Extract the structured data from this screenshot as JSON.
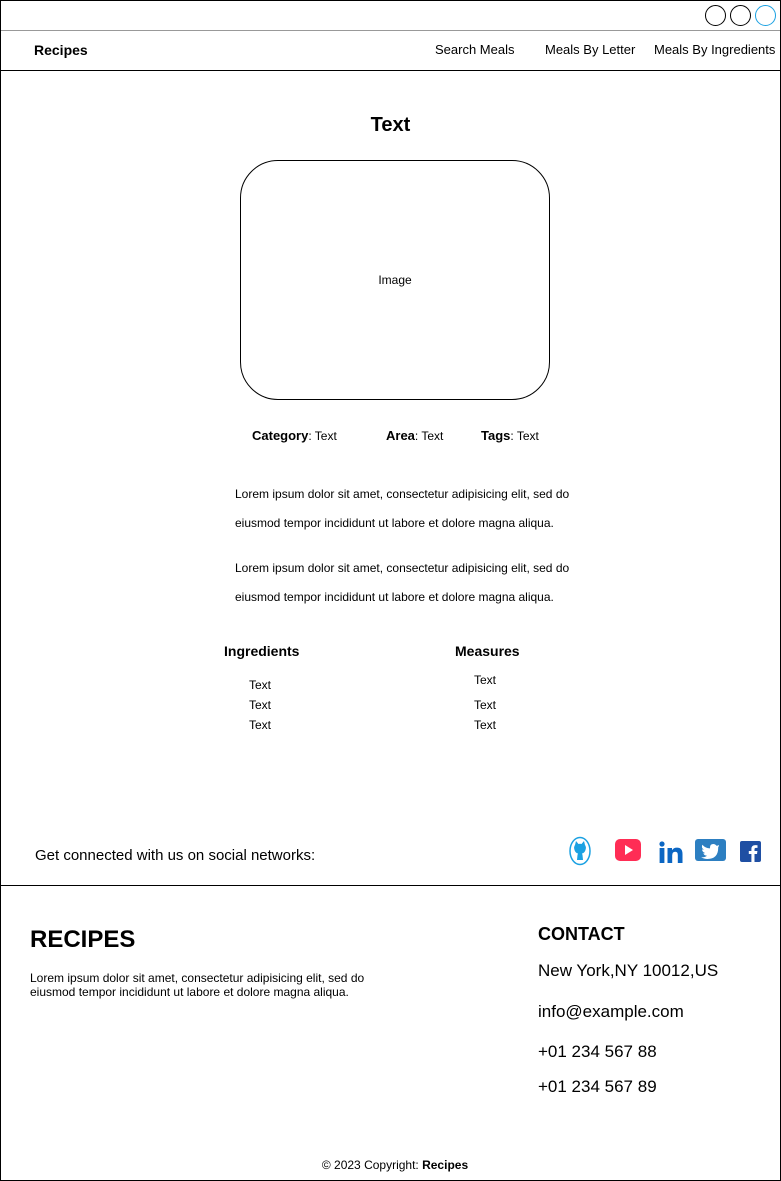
{
  "nav": {
    "brand": "Recipes",
    "links": [
      "Search Meals",
      "Meals By Letter",
      "Meals By Ingredients"
    ]
  },
  "meal": {
    "title": "Text",
    "image_label": "Image",
    "category_label": "Category",
    "category_value": ": Text",
    "area_label": "Area",
    "area_value": ": Text",
    "tags_label": "Tags",
    "tags_value": ": Text",
    "description": [
      "Lorem ipsum dolor sit amet, consectetur adipisicing elit, sed do",
      "eiusmod tempor incididunt ut labore et dolore magna aliqua.",
      "Lorem ipsum dolor sit amet, consectetur adipisicing elit, sed do",
      "eiusmod tempor incididunt ut labore et dolore magna aliqua."
    ],
    "ingredients_heading": "Ingredients",
    "measures_heading": "Measures",
    "ingredients": [
      "Text",
      "Text",
      "Text"
    ],
    "measures": [
      "Text",
      "Text",
      "Text"
    ]
  },
  "social": {
    "text": "Get connected with us on social networks:",
    "icons": [
      "github-icon",
      "youtube-icon",
      "linkedin-icon",
      "twitter-icon",
      "facebook-icon"
    ],
    "colors": {
      "github": "#1ba1e2",
      "youtube": "#ff2d55",
      "linkedin": "#0b66c3",
      "twitter": "#2d7fc1",
      "facebook": "#1f4fa3"
    }
  },
  "footer": {
    "brand": "RECIPES",
    "description": "Lorem ipsum dolor sit amet, consectetur adipisicing elit, sed do eiusmod tempor incididunt ut labore et dolore magna aliqua.",
    "contact_heading": "CONTACT",
    "address": "New York,NY 10012,US",
    "email": "info@example.com",
    "phone1": "+01 234 567 88",
    "phone2": "+01 234 567 89",
    "copyright_prefix": "© 2023 Copyright: ",
    "copyright_brand": "Recipes"
  },
  "window": {
    "controls": [
      "circle-button",
      "circle-button",
      "circle-button-accent"
    ],
    "accent": "#1ba1e2"
  }
}
